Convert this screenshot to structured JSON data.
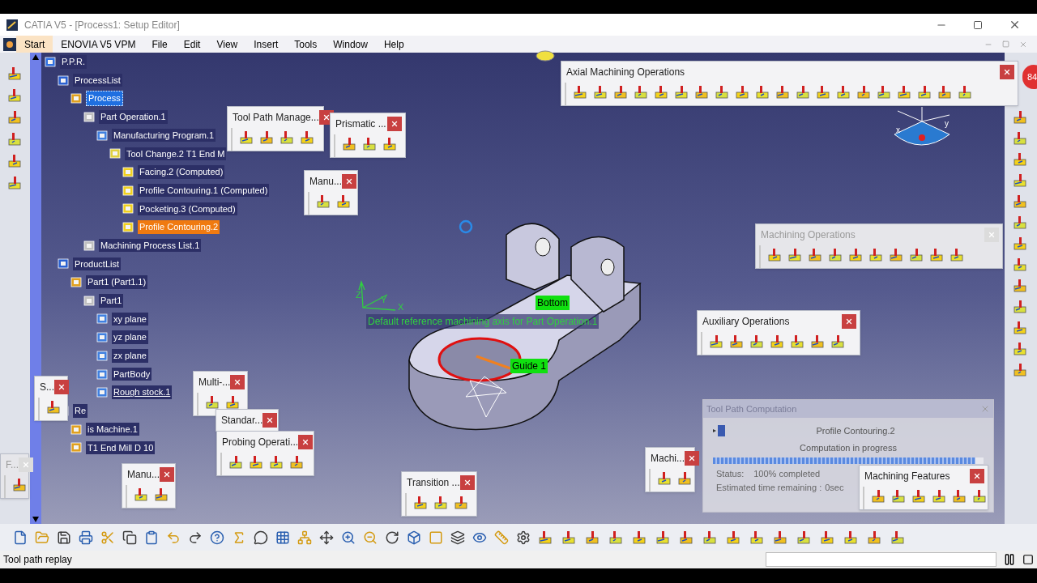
{
  "window": {
    "title": "CATIA V5 - [Process1: Setup Editor]"
  },
  "menu": [
    {
      "label": "Start",
      "selected": true
    },
    {
      "label": "ENOVIA V5 VPM",
      "selected": false
    },
    {
      "label": "File",
      "selected": false
    },
    {
      "label": "Edit",
      "selected": false
    },
    {
      "label": "View",
      "selected": false
    },
    {
      "label": "Insert",
      "selected": false
    },
    {
      "label": "Tools",
      "selected": false
    },
    {
      "label": "Window",
      "selected": false
    },
    {
      "label": "Help",
      "selected": false
    }
  ],
  "tree": [
    {
      "label": "P.P.R.",
      "selected": false,
      "current": false,
      "linked": false,
      "children": [
        {
          "label": "ProcessList",
          "selected": false,
          "current": false,
          "linked": false,
          "children": [
            {
              "label": "Process",
              "selected": true,
              "current": false,
              "linked": false,
              "children": [
                {
                  "label": "Part Operation.1",
                  "selected": false,
                  "current": false,
                  "linked": false,
                  "children": [
                    {
                      "label": "Manufacturing Program.1",
                      "selected": false,
                      "current": false,
                      "linked": false,
                      "children": [
                        {
                          "label": "Tool Change.2  T1 End M",
                          "selected": false,
                          "current": false,
                          "linked": false,
                          "children": [
                            {
                              "label": "Facing.2 (Computed)",
                              "selected": false,
                              "current": false,
                              "linked": false
                            },
                            {
                              "label": "Profile Contouring.1 (Computed)",
                              "selected": false,
                              "current": false,
                              "linked": false
                            },
                            {
                              "label": "Pocketing.3 (Computed)",
                              "selected": false,
                              "current": false,
                              "linked": false
                            },
                            {
                              "label": "Profile Contouring.2",
                              "selected": false,
                              "current": true,
                              "linked": false
                            }
                          ]
                        }
                      ]
                    }
                  ]
                },
                {
                  "label": "Machining Process List.1",
                  "selected": false,
                  "current": false,
                  "linked": false
                }
              ]
            }
          ]
        },
        {
          "label": "ProductList",
          "selected": false,
          "current": false,
          "linked": false,
          "children": [
            {
              "label": "Part1 (Part1.1)",
              "selected": false,
              "current": false,
              "linked": false,
              "children": [
                {
                  "label": "Part1",
                  "selected": false,
                  "current": false,
                  "linked": false,
                  "children": [
                    {
                      "label": "xy plane",
                      "selected": false,
                      "current": false,
                      "linked": false
                    },
                    {
                      "label": "yz plane",
                      "selected": false,
                      "current": false,
                      "linked": false
                    },
                    {
                      "label": "zx plane",
                      "selected": false,
                      "current": false,
                      "linked": false
                    },
                    {
                      "label": "PartBody",
                      "selected": false,
                      "current": false,
                      "linked": false
                    },
                    {
                      "label": "Rough stock.1",
                      "selected": false,
                      "current": false,
                      "linked": true
                    }
                  ]
                }
              ]
            }
          ]
        },
        {
          "label": "Re",
          "selected": false,
          "current": false,
          "linked": false,
          "children": [
            {
              "label": "is Machine.1",
              "selected": false,
              "current": false,
              "linked": false
            },
            {
              "label": "T1 End Mill D 10",
              "selected": false,
              "current": false,
              "linked": false
            }
          ]
        }
      ]
    }
  ],
  "toolbars": [
    {
      "title": "Axial Machining Operations",
      "active": true
    },
    {
      "title": "Tool Path Manage...",
      "active": true
    },
    {
      "title": "Prismatic ...",
      "active": true
    },
    {
      "title": "Manu...",
      "active": true
    },
    {
      "title": "Machining Operations",
      "active": false
    },
    {
      "title": "Auxiliary Operations",
      "active": true
    },
    {
      "title": "S...",
      "active": true
    },
    {
      "title": "Multi-...",
      "active": true
    },
    {
      "title": "Standar...",
      "active": true
    },
    {
      "title": "Manu...",
      "active": true
    },
    {
      "title": "F...",
      "active": false
    },
    {
      "title": "Probing Operati...",
      "active": true
    },
    {
      "title": "Transition ...",
      "active": true
    },
    {
      "title": "Machi...",
      "active": true
    },
    {
      "title": "Machining Features",
      "active": true
    }
  ],
  "viewport": {
    "axis_caption": "Default reference machining axis for Part Operation.1",
    "axis_labels": [
      "Z",
      "Y",
      "X"
    ],
    "compass_labels": [
      "x",
      "y"
    ],
    "tags": [
      "Bottom",
      "Guide 1"
    ],
    "badge": "84"
  },
  "dialog": {
    "title": "Tool Path Computation",
    "operation": "Profile Contouring.2",
    "message": "Computation in progress",
    "progress": {
      "level": 0.97
    },
    "status_label": "Status:",
    "status_value": "100% completed",
    "time_label": "Estimated time remaining :",
    "time_value": "0sec"
  },
  "status_bar": {
    "message": "Tool path replay"
  }
}
